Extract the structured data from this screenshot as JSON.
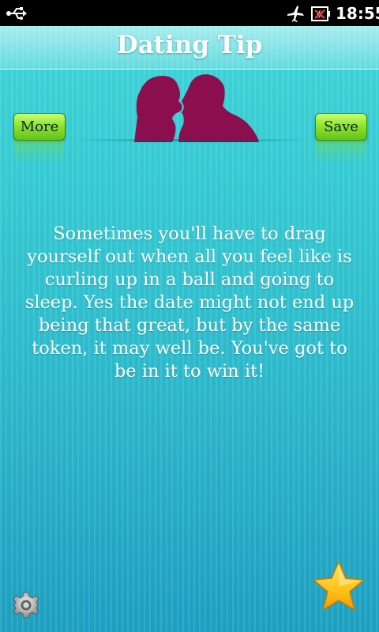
{
  "status_bar": {
    "time": "18:55",
    "icons": [
      "usb-icon",
      "airplane-mode-icon",
      "battery-charging-icon"
    ]
  },
  "header": {
    "title": "Dating Tip"
  },
  "buttons": {
    "more_label": "More",
    "save_label": "Save"
  },
  "tip": {
    "text": "Sometimes you'll have to drag yourself out when all you feel like is curling up in a ball and going to sleep. Yes the date might not end up being that great, but by the same token, it may well be. You've got to be in it to win it!"
  },
  "footer": {
    "icons": [
      "settings-gear-icon",
      "favorite-star-icon"
    ]
  },
  "colors": {
    "background_top": "#3fd7d9",
    "background_bottom": "#1d9fc0",
    "silhouette": "#8b0f4e",
    "button_green": "#8ee52f",
    "star_gold": "#ffc21a"
  }
}
